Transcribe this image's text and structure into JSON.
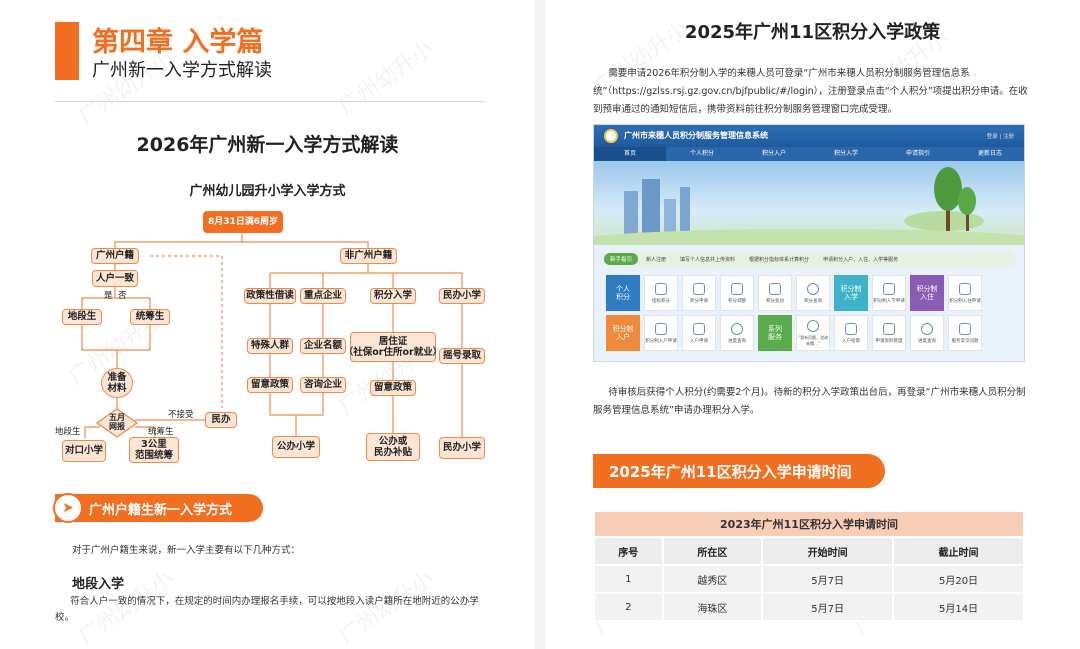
{
  "left": {
    "chapter_title": "第四章 入学篇",
    "chapter_subtitle": "广州新一入学方式解读",
    "doc_title": "2026年广州新一入学方式解读",
    "flow_title": "广州幼儿园升小学入学方式",
    "flow": {
      "root": "8月31日满6周岁",
      "gz_hukou": "广州户籍",
      "non_gz_hukou": "非广州户籍",
      "consistent": "人户一致",
      "yes": "是",
      "no": "否",
      "district_student": "地段生",
      "coordinated_student": "统筹生",
      "prepare": "准备\n材料",
      "may_apply": "五月\n网报",
      "not_accepted": "不接受",
      "private_small": "民办",
      "district_label": "地段生",
      "coordinated_label": "统筹生",
      "matched_school": "对口小学",
      "range_coord": "3公里\n范围统筹",
      "policy": "政策性借读",
      "key_enterprise": "重点企业",
      "points": "积分入学",
      "private_school": "民办小学",
      "special": "特殊人群",
      "ent_quota": "企业名额",
      "residence": "居住证\n（社保or住所or就业）",
      "lottery": "摇号录取",
      "policy_stay": "留意政策",
      "consult_ent": "咨询企业",
      "policy_stay2": "留意政策",
      "public_school": "公办小学",
      "public_or_subsidy": "公办或\n民办补贴",
      "private_school2": "民办小学"
    },
    "banner": "广州户籍生新一入学方式",
    "intro": "对于广州户籍生来说，新一入学主要有以下几种方式：",
    "section_heading": "地段入学",
    "section_text": "符合人户一致的情况下，在规定的时间内办理报名手续，可以按地段入读户籍所在地附近的公办学校。",
    "watermark": "广州幼升小"
  },
  "right": {
    "title": "2025年广州11区积分入学政策",
    "para1": "需要申请2026年积分制入学的来穗人员可登录“广州市来穗人员积分制服务管理信息系统”（https://gzlss.rsj.gz.gov.cn/bjfpublic/#/login），注册登录点击“个人积分”项提出积分申请。在收到预审通过的通知短信后，携带资料前往积分制服务管理窗口完成受理。",
    "portal": {
      "name": "广州市来穗人员积分制服务管理信息系统",
      "login": "登录 | 注册",
      "nav": [
        "首页",
        "个人积分",
        "积分入户",
        "积分入学",
        "申请指引",
        "更新日志"
      ],
      "steps_label": "新手指引",
      "steps": [
        "新人注册",
        "填写个人信息并上传资料",
        "根据积分指标体系计算积分",
        "申请积分入户、入住、入学等服务"
      ],
      "big1": "个人\n积分",
      "big2": "积分制\n入学",
      "big3": "积分制\n入住",
      "big4": "积分制\n入户",
      "big5": "系列\n服务",
      "tiles_row1": [
        "指标积分",
        "积分申请",
        "积分调整",
        "积分变动",
        "积分查询",
        "积分制入学申请",
        "积分制入住申请"
      ],
      "tiles_row2": [
        "积分制入户申请",
        "入户申请",
        "进度查询",
        "“我有问题，咨询来穗…”",
        "入户指南",
        "申请资料管理",
        "进度查询",
        "服务常见问题"
      ]
    },
    "para2": "待审核后获得个人积分(约需要2个月)。待新的积分入学政策出台后，再登录“广州市来穗人员积分制服务管理信息系统”申请办理积分入学。",
    "banner": "2025年广州11区积分入学申请时间",
    "table": {
      "caption": "2023年广州11区积分入学申请时间",
      "headers": [
        "序号",
        "所在区",
        "开始时间",
        "截止时间"
      ],
      "rows": [
        [
          "1",
          "越秀区",
          "5月7日",
          "5月20日"
        ],
        [
          "2",
          "海珠区",
          "5月7日",
          "5月14日"
        ]
      ]
    },
    "watermark": "广州幼升小"
  }
}
